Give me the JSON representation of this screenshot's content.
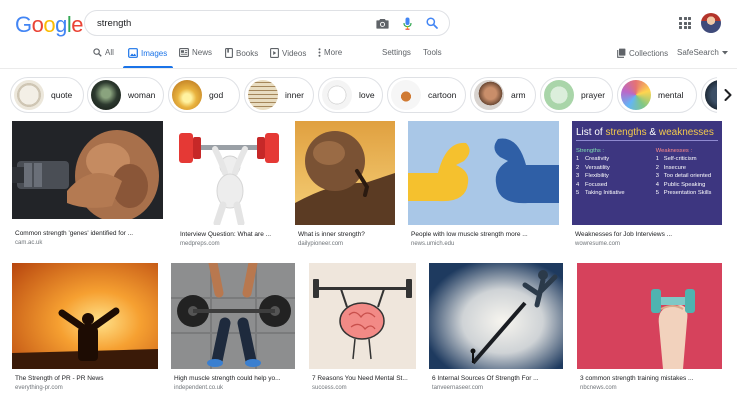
{
  "header": {
    "logo_letters": [
      {
        "ch": "G",
        "color": "#4285f4"
      },
      {
        "ch": "o",
        "color": "#ea4335"
      },
      {
        "ch": "o",
        "color": "#fbbc05"
      },
      {
        "ch": "g",
        "color": "#4285f4"
      },
      {
        "ch": "l",
        "color": "#34a853"
      },
      {
        "ch": "e",
        "color": "#ea4335"
      }
    ],
    "search_value": "strength",
    "icons": [
      "camera-icon",
      "microphone-icon",
      "search-icon",
      "apps-icon"
    ]
  },
  "tabs": {
    "all": "All",
    "images": "Images",
    "news": "News",
    "books": "Books",
    "videos": "Videos",
    "more": "More",
    "settings": "Settings",
    "tools": "Tools",
    "collections": "Collections",
    "safesearch": "SafeSearch"
  },
  "accent_color": "#1a73e8",
  "chips": [
    "quote",
    "woman",
    "god",
    "inner",
    "love",
    "cartoon",
    "arm",
    "prayer",
    "mental"
  ],
  "results": [
    {
      "caption": "Common strength 'genes' identified for ...",
      "source": "cam.ac.uk"
    },
    {
      "caption": "Interview Question: What are ...",
      "source": "medpreps.com"
    },
    {
      "caption": "What is inner strength?",
      "source": "dailypioneer.com"
    },
    {
      "caption": "People with low muscle strength more ...",
      "source": "news.umich.edu"
    },
    {
      "caption": "Weaknesses for Job Interviews ...",
      "source": "wowresume.com"
    },
    {
      "caption": "The Strength of PR - PR News",
      "source": "everything-pr.com"
    },
    {
      "caption": "High muscle strength could help yo...",
      "source": "independent.co.uk"
    },
    {
      "caption": "7 Reasons You Need Mental St...",
      "source": "success.com"
    },
    {
      "caption": "6 Internal Sources Of Strength For ...",
      "source": "tanveernaseer.com"
    },
    {
      "caption": "3 common strength training mistakes ...",
      "source": "nbcnews.com"
    }
  ],
  "slide": {
    "title_parts": [
      "List of ",
      "strengths",
      " & ",
      "weaknesses"
    ],
    "strengths_heading": "Strengths :",
    "weaknesses_heading": "Weaknesses :",
    "strengths": [
      "Creativity",
      "Versatility",
      "Flexibility",
      "Focused",
      "Taking Initiative"
    ],
    "weaknesses": [
      "Self-criticism",
      "Insecure",
      "Too detail oriented",
      "Public Speaking",
      "Presentation Skills"
    ],
    "numbers": [
      "1",
      "2",
      "3",
      "4",
      "5"
    ]
  }
}
